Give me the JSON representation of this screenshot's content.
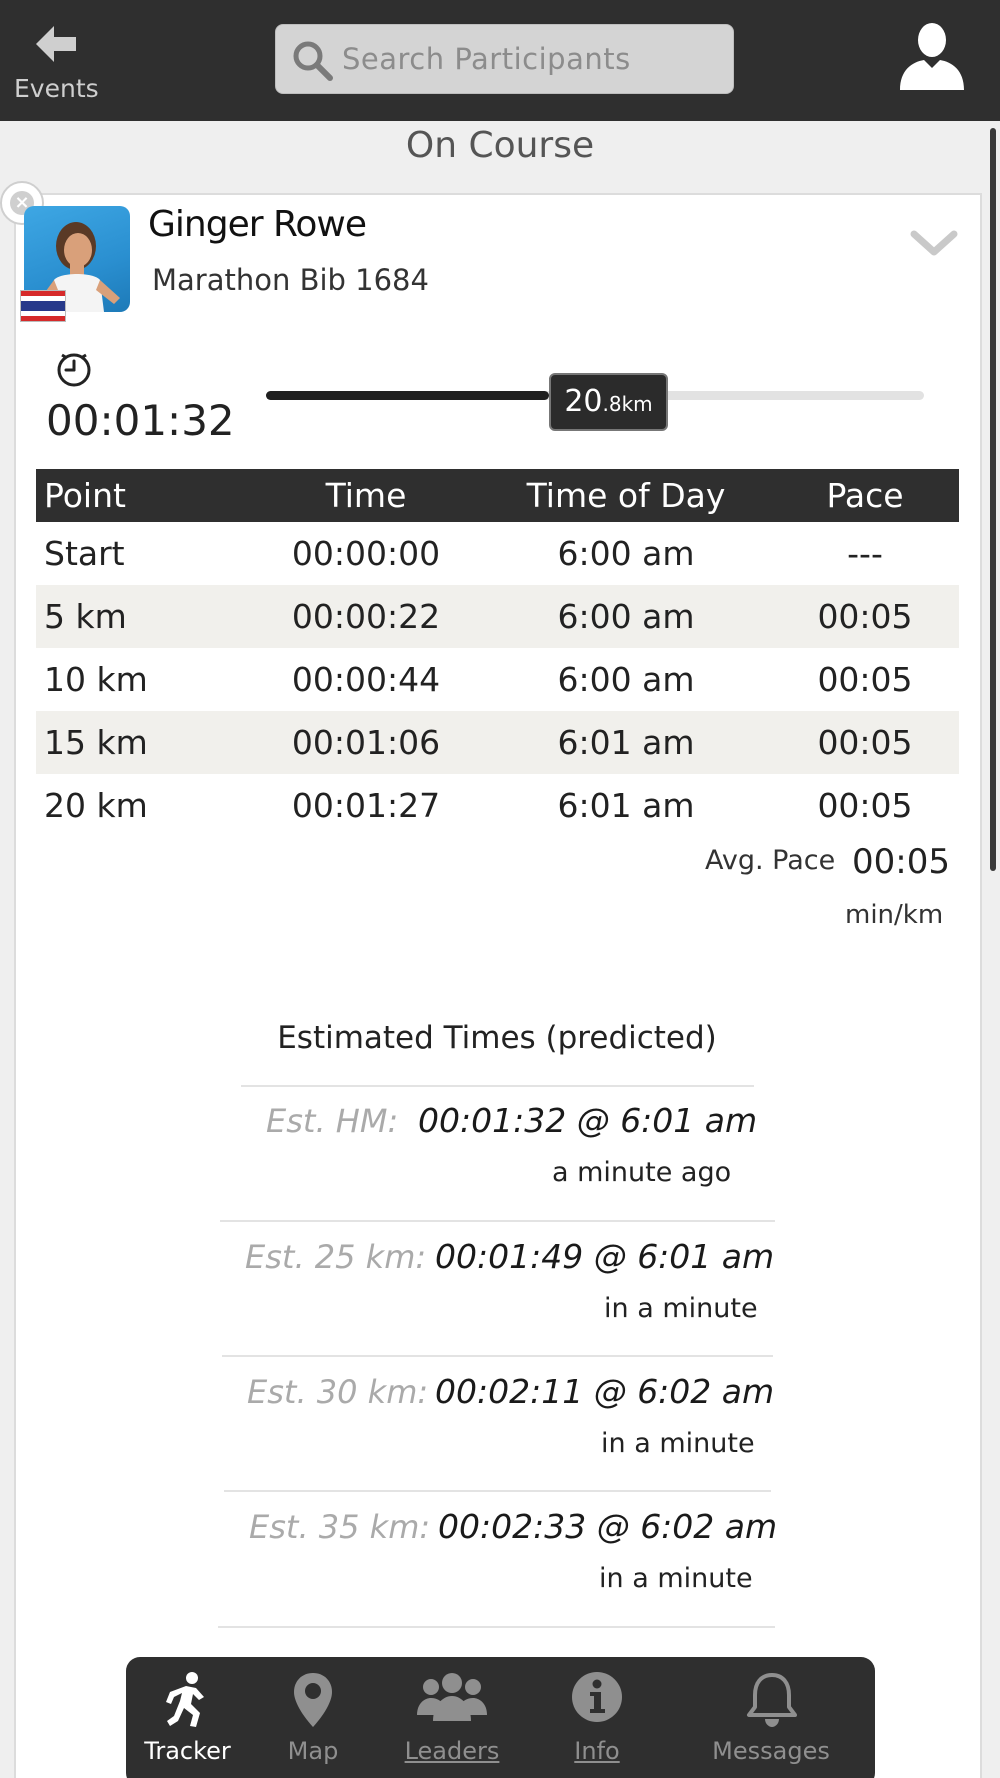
{
  "header": {
    "back_label": "Events",
    "search_placeholder": "Search Participants"
  },
  "section_title": "On Course",
  "participant": {
    "name": "Ginger Rowe",
    "bib": "Marathon Bib 1684",
    "flag": "thailand-flag",
    "elapsed": "00:01:32",
    "distance_whole": "20",
    "distance_fraction": ".8",
    "distance_unit": "km",
    "progress_fraction": 0.43
  },
  "splits": {
    "headers": [
      "Point",
      "Time",
      "Time of Day",
      "Pace"
    ],
    "rows": [
      [
        "Start",
        "00:00:00",
        "6:00 am",
        "---"
      ],
      [
        "5 km",
        "00:00:22",
        "6:00 am",
        "00:05"
      ],
      [
        "10 km",
        "00:00:44",
        "6:00 am",
        "00:05"
      ],
      [
        "15 km",
        "00:01:06",
        "6:01 am",
        "00:05"
      ],
      [
        "20 km",
        "00:01:27",
        "6:01 am",
        "00:05"
      ]
    ]
  },
  "avg_pace": {
    "label": "Avg. Pace",
    "value": "00:05",
    "unit": "min/km"
  },
  "estimates": {
    "title": "Estimated Times (predicted)",
    "items": [
      {
        "label": "Est. HM:",
        "value": "00:01:32 @ 6:01 am",
        "relative": "a minute ago"
      },
      {
        "label": "Est. 25 km:",
        "value": "00:01:49 @ 6:01 am",
        "relative": "in a minute"
      },
      {
        "label": "Est. 30 km:",
        "value": "00:02:11 @ 6:02 am",
        "relative": "in a minute"
      },
      {
        "label": "Est. 35 km:",
        "value": "00:02:33 @ 6:02 am",
        "relative": "in a minute"
      }
    ]
  },
  "nav": {
    "items": [
      {
        "label": "Tracker",
        "icon": "runner-icon"
      },
      {
        "label": "Map",
        "icon": "map-pin-icon"
      },
      {
        "label": "Leaders",
        "icon": "group-icon"
      },
      {
        "label": "Info",
        "icon": "info-icon"
      },
      {
        "label": "Messages",
        "icon": "bell-icon"
      }
    ]
  },
  "colors": {
    "bar": "#2f2f2f",
    "alt_row": "#f1f0ec",
    "muted_label": "#aaaaaa"
  }
}
